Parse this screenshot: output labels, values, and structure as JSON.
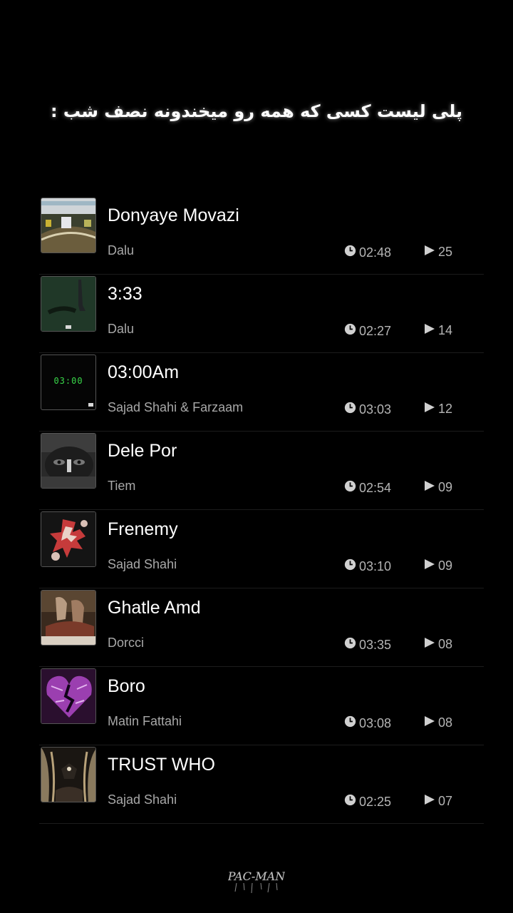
{
  "header": {
    "title": "پلی لیست کسی که همه رو میخندونه نصف شب :"
  },
  "tracks": [
    {
      "title": "Donyaye Movazi",
      "artist": "Dalu",
      "duration": "02:48",
      "plays": "25"
    },
    {
      "title": "3:33",
      "artist": "Dalu",
      "duration": "02:27",
      "plays": "14"
    },
    {
      "title": "03:00Am",
      "artist": "Sajad Shahi & Farzaam",
      "duration": "03:03",
      "plays": "12",
      "cover_text": "03:00"
    },
    {
      "title": "Dele Por",
      "artist": "Tiem",
      "duration": "02:54",
      "plays": "09"
    },
    {
      "title": "Frenemy",
      "artist": "Sajad Shahi",
      "duration": "03:10",
      "plays": "09"
    },
    {
      "title": "Ghatle Amd",
      "artist": "Dorcci",
      "duration": "03:35",
      "plays": "08"
    },
    {
      "title": "Boro",
      "artist": "Matin Fattahi",
      "duration": "03:08",
      "plays": "08"
    },
    {
      "title": "TRUST WHO",
      "artist": "Sajad Shahi",
      "duration": "02:25",
      "plays": "07"
    }
  ],
  "icons": {
    "duration": "clock-icon",
    "plays": "play-icon"
  },
  "watermark": {
    "text": "PAC-MAN"
  },
  "colors": {
    "background": "#000000",
    "title_text": "#ffffff",
    "secondary_text": "#a8a8a8",
    "divider": "#1c1c1c"
  }
}
